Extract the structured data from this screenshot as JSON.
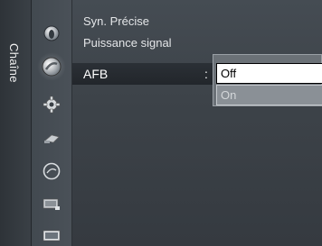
{
  "category": {
    "label": "Chaîne"
  },
  "icons": [
    {
      "name": "picture-icon",
      "active": false
    },
    {
      "name": "channel-icon",
      "active": true
    },
    {
      "name": "setup-icon",
      "active": false
    },
    {
      "name": "input-icon",
      "active": false
    },
    {
      "name": "application-icon",
      "active": false
    },
    {
      "name": "support-icon",
      "active": false
    },
    {
      "name": "screen-icon",
      "active": false
    }
  ],
  "menu": {
    "items": [
      {
        "label": "Syn. Précise"
      },
      {
        "label": "Puissance signal"
      }
    ],
    "selected": {
      "label": "AFB",
      "separator": ":"
    }
  },
  "popup": {
    "options": [
      "Off",
      "On"
    ],
    "selected": "Off"
  }
}
